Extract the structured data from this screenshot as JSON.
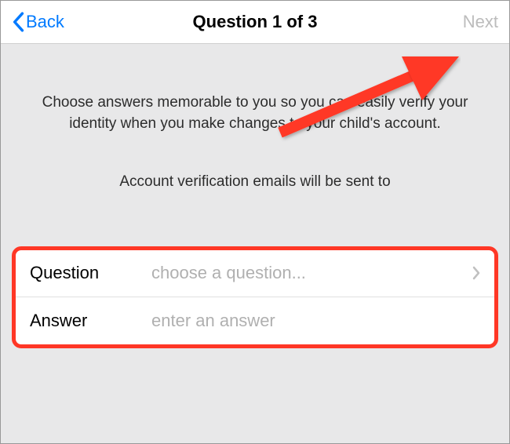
{
  "nav": {
    "back_label": "Back",
    "title": "Question 1 of 3",
    "next_label": "Next"
  },
  "intro": {
    "primary": "Choose answers memorable to you so you can easily verify your identity when you make changes to your child's account.",
    "secondary": "Account verification emails will be sent to"
  },
  "form": {
    "question": {
      "label": "Question",
      "placeholder": "choose a question..."
    },
    "answer": {
      "label": "Answer",
      "placeholder": "enter an answer"
    }
  },
  "colors": {
    "accent": "#007aff",
    "annotation": "#ff3726",
    "disabled": "#bcbcbc",
    "placeholder": "#b0b0b0"
  }
}
